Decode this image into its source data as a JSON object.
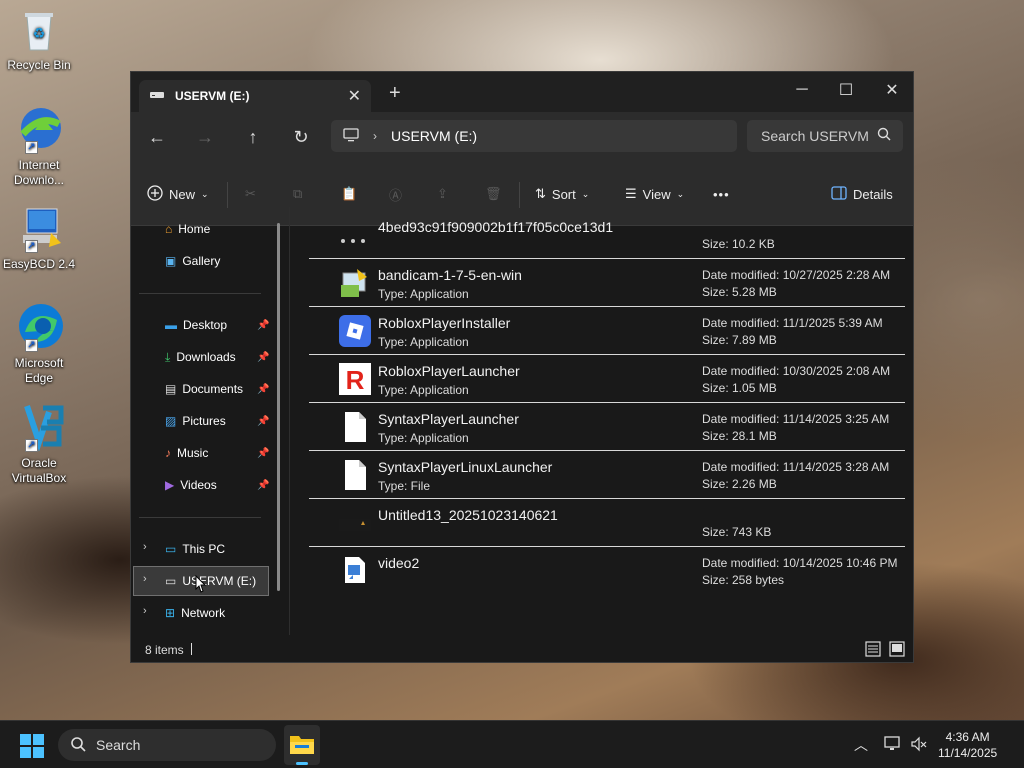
{
  "desktop": {
    "icons": [
      {
        "label": "Recycle Bin",
        "icon": "recycle-bin-icon"
      },
      {
        "label": "Internet Downlo...",
        "icon": "internet-download-manager-icon"
      },
      {
        "label": "EasyBCD 2.4",
        "icon": "easybcd-icon"
      },
      {
        "label": "Microsoft Edge",
        "icon": "edge-icon"
      },
      {
        "label": "Oracle VirtualBox",
        "icon": "virtualbox-icon"
      }
    ]
  },
  "window": {
    "tab_title": "USERVM (E:)",
    "breadcrumb": "USERVM (E:)",
    "search_placeholder": "Search USERVM",
    "toolbar": {
      "new_label": "New",
      "sort_label": "Sort",
      "view_label": "View",
      "more_label": "•••",
      "details_label": "Details"
    },
    "nav": {
      "quick": [
        {
          "label": "Home",
          "icon": "home-icon"
        },
        {
          "label": "Gallery",
          "icon": "gallery-icon"
        }
      ],
      "pinned": [
        {
          "label": "Desktop",
          "icon": "desktop-folder-icon"
        },
        {
          "label": "Downloads",
          "icon": "downloads-icon"
        },
        {
          "label": "Documents",
          "icon": "documents-icon"
        },
        {
          "label": "Pictures",
          "icon": "pictures-icon"
        },
        {
          "label": "Music",
          "icon": "music-icon"
        },
        {
          "label": "Videos",
          "icon": "videos-icon"
        }
      ],
      "locations": [
        {
          "label": "This PC",
          "icon": "this-pc-icon"
        },
        {
          "label": "USERVM (E:)",
          "icon": "drive-icon"
        },
        {
          "label": "Network",
          "icon": "network-icon"
        }
      ]
    },
    "files": [
      {
        "name": "4bed93c91f909002b1f17f05c0ce13d1",
        "type": "",
        "modified": "",
        "size": "Size: 10.2 KB",
        "icon": "unknown-file-icon"
      },
      {
        "name": "bandicam-1-7-5-en-win",
        "type": "Type: Application",
        "modified": "Date modified: 10/27/2025 2:28 AM",
        "size": "Size: 5.28 MB",
        "icon": "installer-icon"
      },
      {
        "name": "RobloxPlayerInstaller",
        "type": "Type: Application",
        "modified": "Date modified: 11/1/2025 5:39 AM",
        "size": "Size: 7.89 MB",
        "icon": "roblox-icon"
      },
      {
        "name": "RobloxPlayerLauncher",
        "type": "Type: Application",
        "modified": "Date modified: 10/30/2025 2:08 AM",
        "size": "Size: 1.05 MB",
        "icon": "roblox-r-icon"
      },
      {
        "name": "SyntaxPlayerLauncher",
        "type": "Type: Application",
        "modified": "Date modified: 11/14/2025 3:25 AM",
        "size": "Size: 28.1 MB",
        "icon": "blank-file-icon"
      },
      {
        "name": "SyntaxPlayerLinuxLauncher",
        "type": "Type: File",
        "modified": "Date modified: 11/14/2025 3:28 AM",
        "size": "Size: 2.26 MB",
        "icon": "blank-file-icon"
      },
      {
        "name": "Untitled13_20251023140621",
        "type": "",
        "modified": "",
        "size": "Size: 743 KB",
        "icon": "image-thumbnail-icon"
      },
      {
        "name": "video2",
        "type": "",
        "modified": "Date modified: 10/14/2025 10:46 PM",
        "size": "Size: 258 bytes",
        "icon": "shortcut-file-icon"
      }
    ],
    "status": {
      "items_count": "8 items"
    }
  },
  "taskbar": {
    "search_label": "Search",
    "time": "4:36 AM",
    "date": "11/14/2025"
  },
  "colors": {
    "window_bg": "#191919",
    "accent": "#3a9bdc"
  }
}
